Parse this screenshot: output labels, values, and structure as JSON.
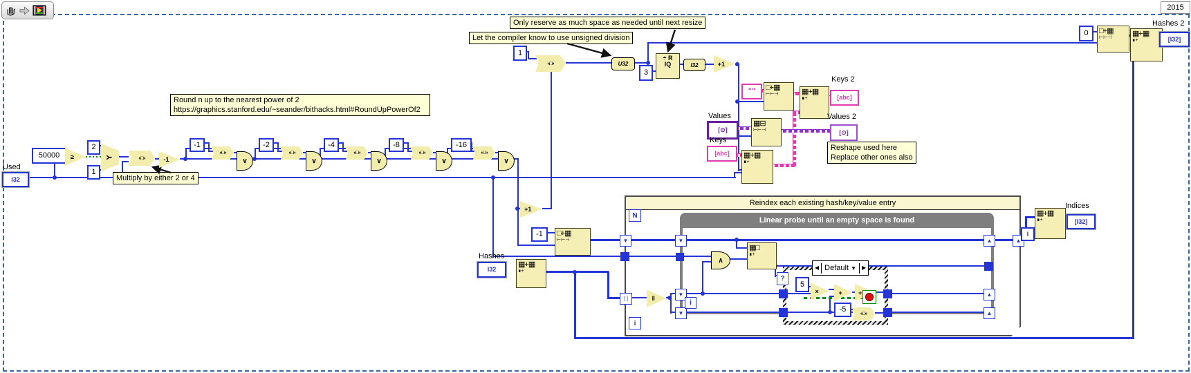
{
  "window": {
    "year_badge": "2015"
  },
  "toolbar": {
    "icons": [
      "pan-hand-icon",
      "forward-arrow-icon",
      "vi-run-icon"
    ]
  },
  "comments": {
    "reserve": "Only reserve as much space as needed until next resize",
    "compiler": "Let the compiler know to use unsigned division",
    "round1": "Round n up to the nearest power of 2",
    "round2": "https://graphics.stanford.edu/~seander/bithacks.html#RoundUpPowerOf2",
    "multiply": "Multiply by either 2 or 4",
    "reshape1": "Reshape used here",
    "reshape2": "Replace other ones also"
  },
  "labels": {
    "used": "Used",
    "hashes": "Hashes",
    "keys": "Keys",
    "values": "Values",
    "keys2": "Keys 2",
    "values2": "Values 2",
    "hashes2": "Hashes 2",
    "indices": "Indices"
  },
  "terminals": {
    "used": "I32",
    "hashes": "I32",
    "hashes2": "[I32]",
    "indices": "[I32]",
    "keys": "[abc]",
    "keys2": "[abc]",
    "values": "[⊙]",
    "values2": "[⊙]"
  },
  "constants": {
    "n50000": "50000",
    "two": "2",
    "one_sel": "1",
    "m1": "-1",
    "m2": "-2",
    "m4": "-4",
    "m8": "-8",
    "m16": "-16",
    "one_shift": "1",
    "three": "3",
    "zero": "0",
    "m1_init": "-1",
    "five": "5",
    "m5": "-5",
    "i_idx": "i",
    "empty_string": "\"\""
  },
  "structures": {
    "for_title": "Reindex each existing hash/key/value entry",
    "for_count": "N",
    "for_iteration": "i",
    "while_title": "Linear probe until an empty space is found",
    "while_iteration": "i",
    "case_prev": "◀",
    "case_label": "Default",
    "case_drop": "▼",
    "case_next": "▶",
    "case_selector": "?"
  },
  "glyphs": {
    "ge": "≥",
    "select": "Y",
    "shift": "«□»",
    "or": "∨",
    "and": "∧",
    "inc": "+1",
    "dec": "-1",
    "mul": "×",
    "add": "+",
    "bars": "‖",
    "u32": "U32",
    "i32": "I32",
    "quot_top": "÷ R",
    "quot_bot": "IQ",
    "down": "▼",
    "up": "▲",
    "autoindex": "[ ]",
    "g_init_main": "□+▦",
    "g_init_sub": "⊢⊢⊣",
    "g_rep_main": "▦+▦",
    "g_rep_sub": "∎+",
    "g_resh_main": "▦⊟",
    "g_resh_sub": "⊢⊢⊣",
    "g_idx_main": "▦□",
    "g_idx_sub": "∎+"
  }
}
